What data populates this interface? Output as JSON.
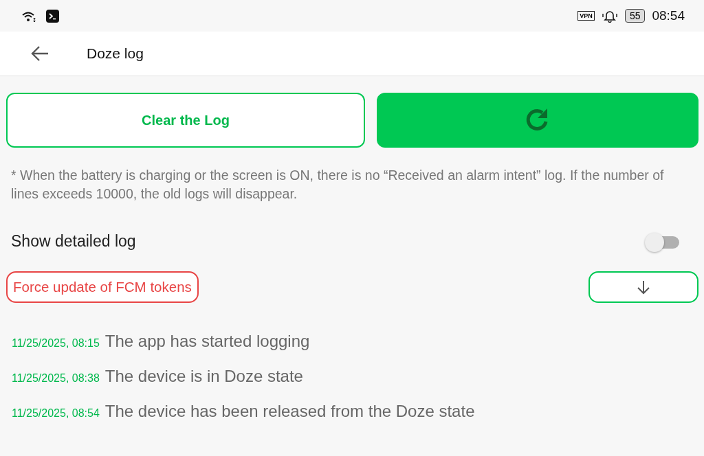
{
  "status_bar": {
    "vpn": "VPN",
    "battery": "55",
    "time": "08:54"
  },
  "app_bar": {
    "title": "Doze log"
  },
  "buttons": {
    "clear": "Clear the Log"
  },
  "note": "* When the battery is charging or the screen is ON, there is no “Received an alarm intent” log. If the number of lines exceeds 10000, the old logs will disappear.",
  "detailed_log": {
    "label": "Show detailed log",
    "on": false
  },
  "force_update": "Force update of FCM tokens",
  "log": [
    {
      "time": "11/25/2025, 08:15",
      "message": "The app has started logging"
    },
    {
      "time": "11/25/2025, 08:38",
      "message": "The device is in Doze state"
    },
    {
      "time": "11/25/2025, 08:54",
      "message": "The device has been released from the Doze state"
    }
  ]
}
